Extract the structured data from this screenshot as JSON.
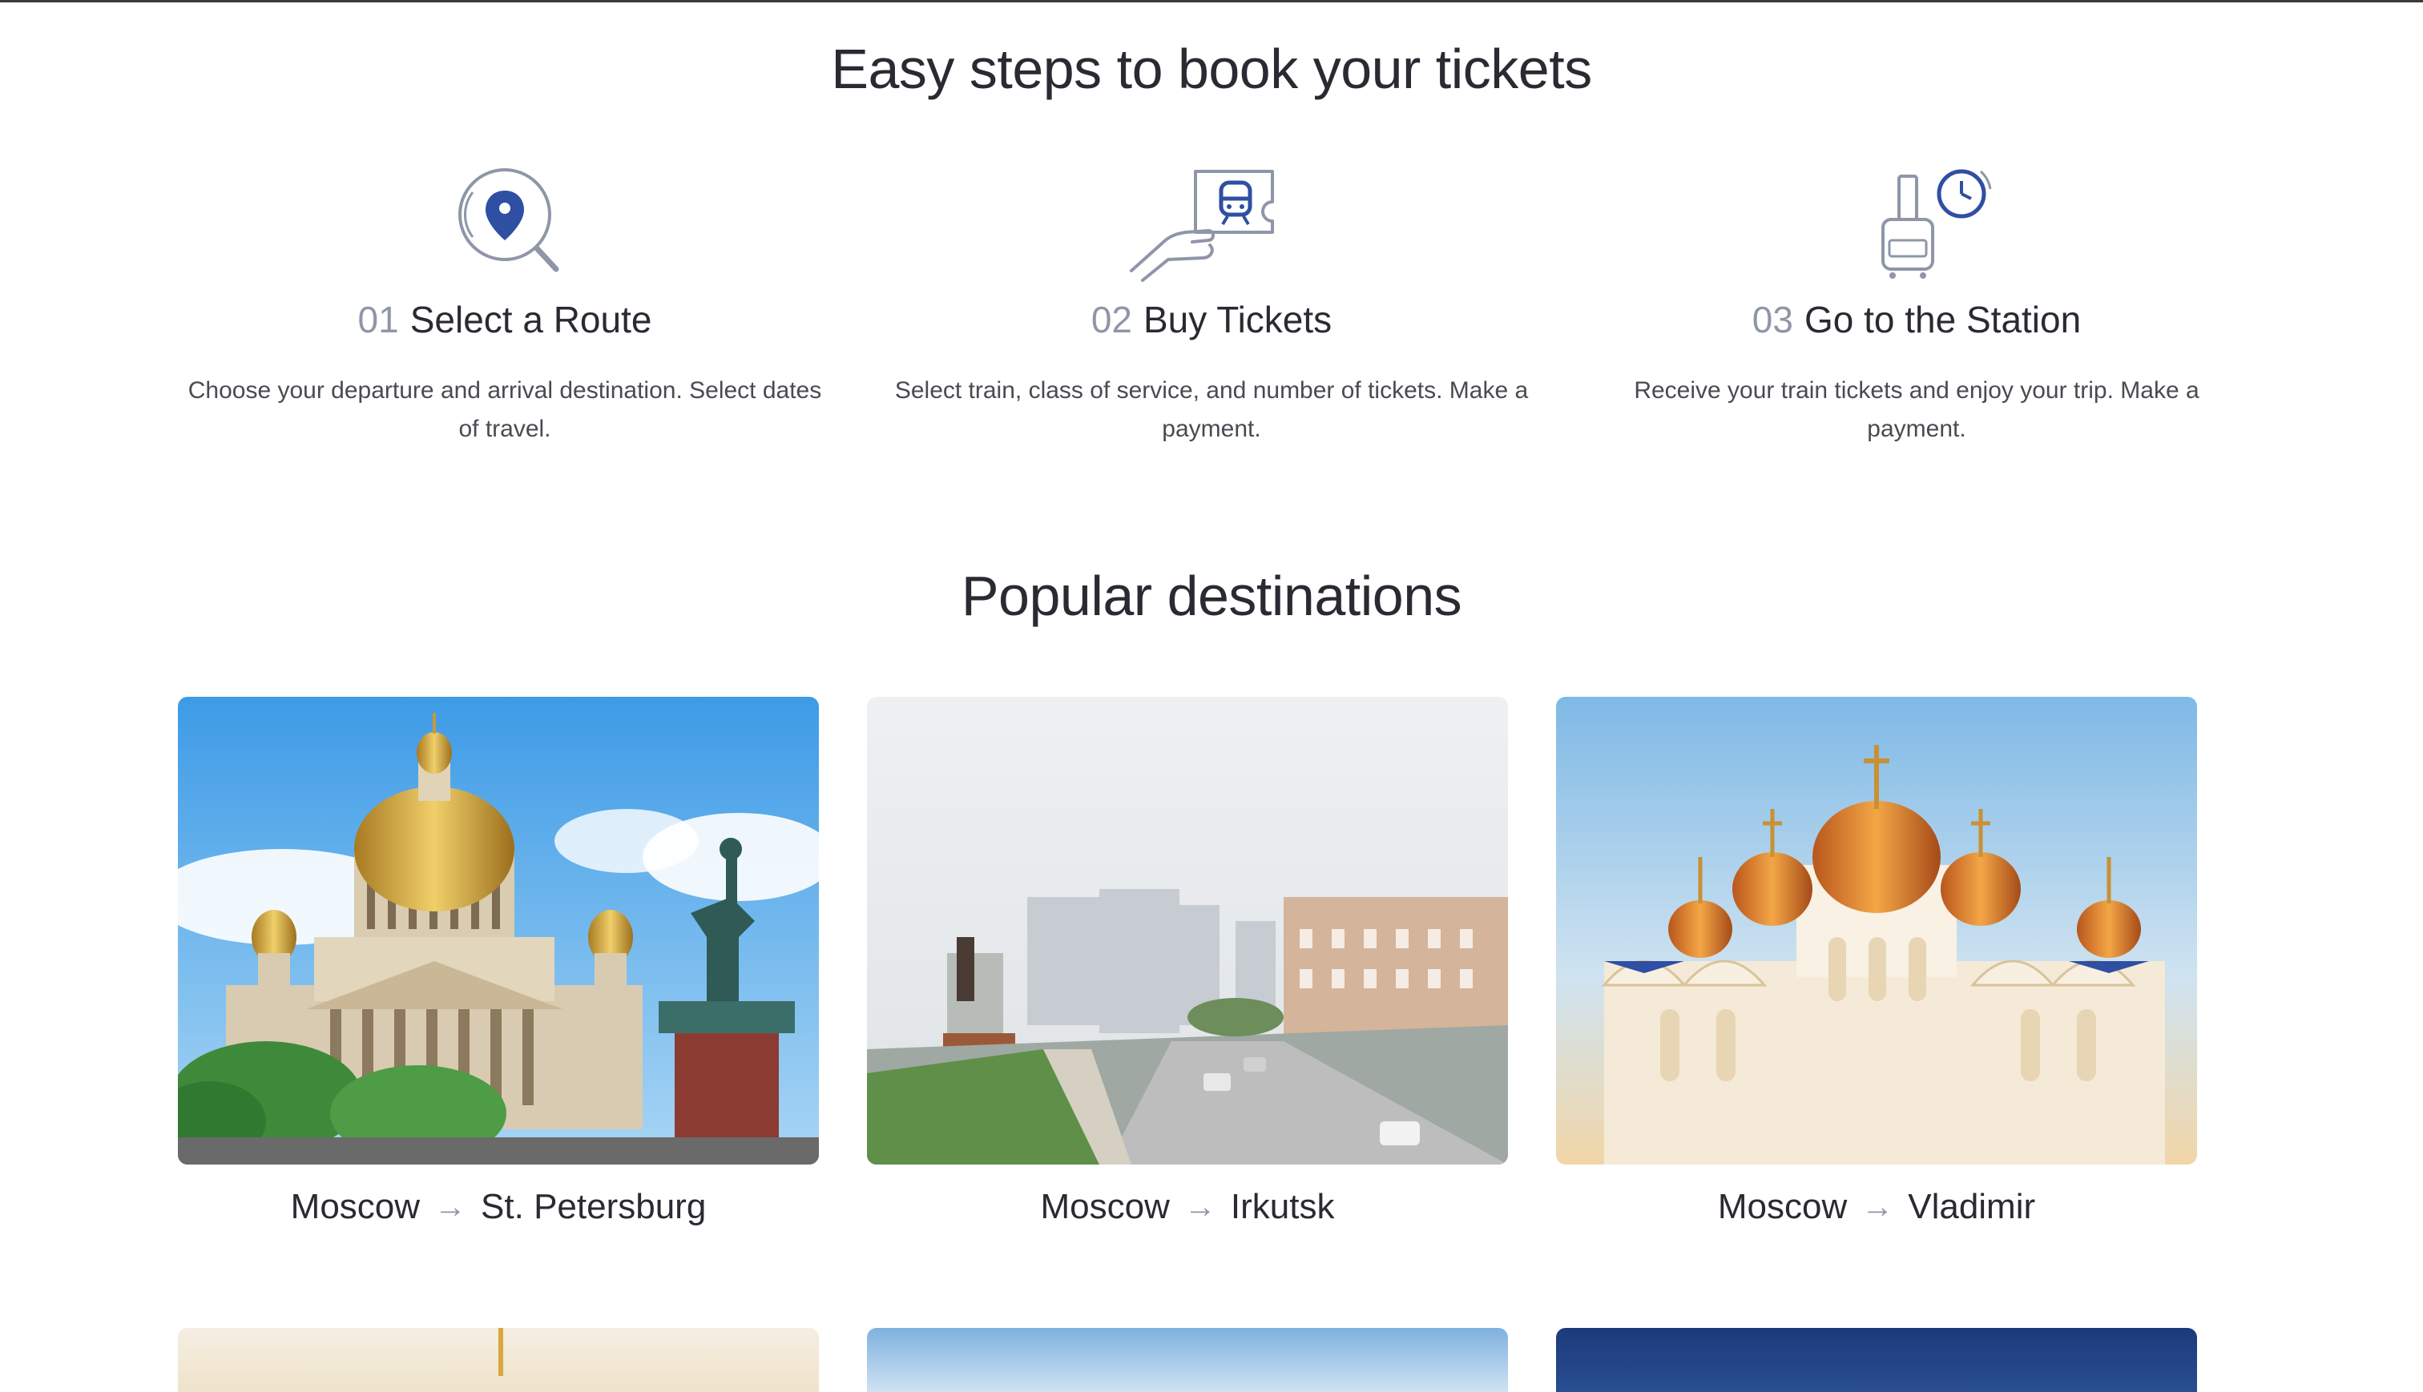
{
  "steps_section": {
    "title": "Easy steps to book your tickets",
    "steps": [
      {
        "number": "01",
        "title": "Select a Route",
        "description": "Choose your departure and arrival destination. Select dates of travel.",
        "icon": "map-search-icon"
      },
      {
        "number": "02",
        "title": "Buy Tickets",
        "description": "Select train, class of service, and number of tickets. Make a payment.",
        "icon": "ticket-hand-icon"
      },
      {
        "number": "03",
        "title": "Go to the Station",
        "description": "Receive your train tickets and enjoy your trip. Make a payment.",
        "icon": "luggage-clock-icon"
      }
    ]
  },
  "destinations_section": {
    "title": "Popular destinations",
    "cards": [
      {
        "from": "Moscow",
        "to": "St. Petersburg",
        "arrow": "→"
      },
      {
        "from": "Moscow",
        "to": "Irkutsk",
        "arrow": "→"
      },
      {
        "from": "Moscow",
        "to": "Vladimir",
        "arrow": "→"
      }
    ]
  },
  "colors": {
    "accent": "#2f4fa3",
    "icon_outline": "#8e96a8",
    "heading": "#2a2a32",
    "body_text": "#4a4a52"
  }
}
